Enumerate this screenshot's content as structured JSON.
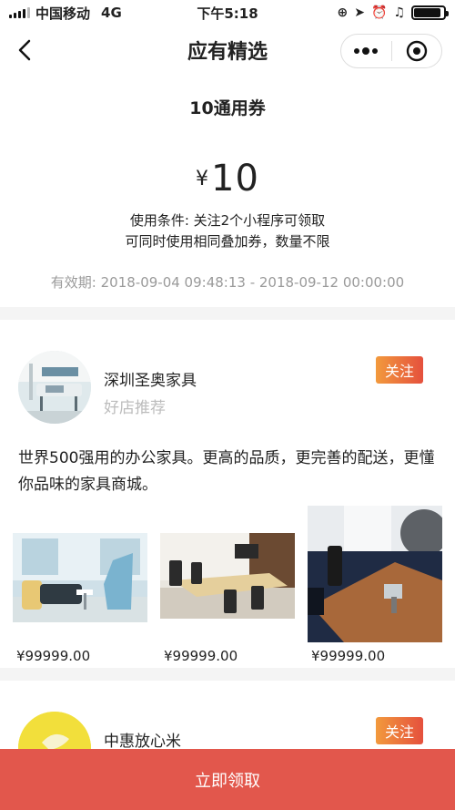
{
  "status_bar": {
    "carrier": "中国移动",
    "network": "4G",
    "time": "下午5:18"
  },
  "navbar": {
    "title": "应有精选",
    "back_icon": "chevron-left-icon",
    "more_icon": "more-dots-icon",
    "close_icon": "target-icon"
  },
  "coupon": {
    "title": "10通用券",
    "currency": "¥",
    "amount": "10",
    "condition_line1": "使用条件: 关注2个小程序可领取",
    "condition_line2": "可同时使用相同叠加券，数量不限",
    "validity": "有效期: 2018-09-04 09:48:13 - 2018-09-12 00:00:00"
  },
  "stores": [
    {
      "name": "深圳圣奥家具",
      "subtitle": "好店推荐",
      "follow_label": "关注",
      "description": "世界500强用的办公家具。更高的品质，更完善的配送，更懂你品味的家具商城。",
      "products": [
        {
          "price": "¥99999.00"
        },
        {
          "price": "¥99999.00"
        },
        {
          "price": "¥99999.00"
        }
      ]
    },
    {
      "name": "中惠放心米",
      "follow_label": "关注"
    }
  ],
  "bottom_button": {
    "label": "立即领取"
  },
  "colors": {
    "accent": "#e2574c",
    "follow_gradient_start": "#f29a3d",
    "follow_gradient_end": "#e5503d",
    "muted": "#9a9a9a"
  }
}
